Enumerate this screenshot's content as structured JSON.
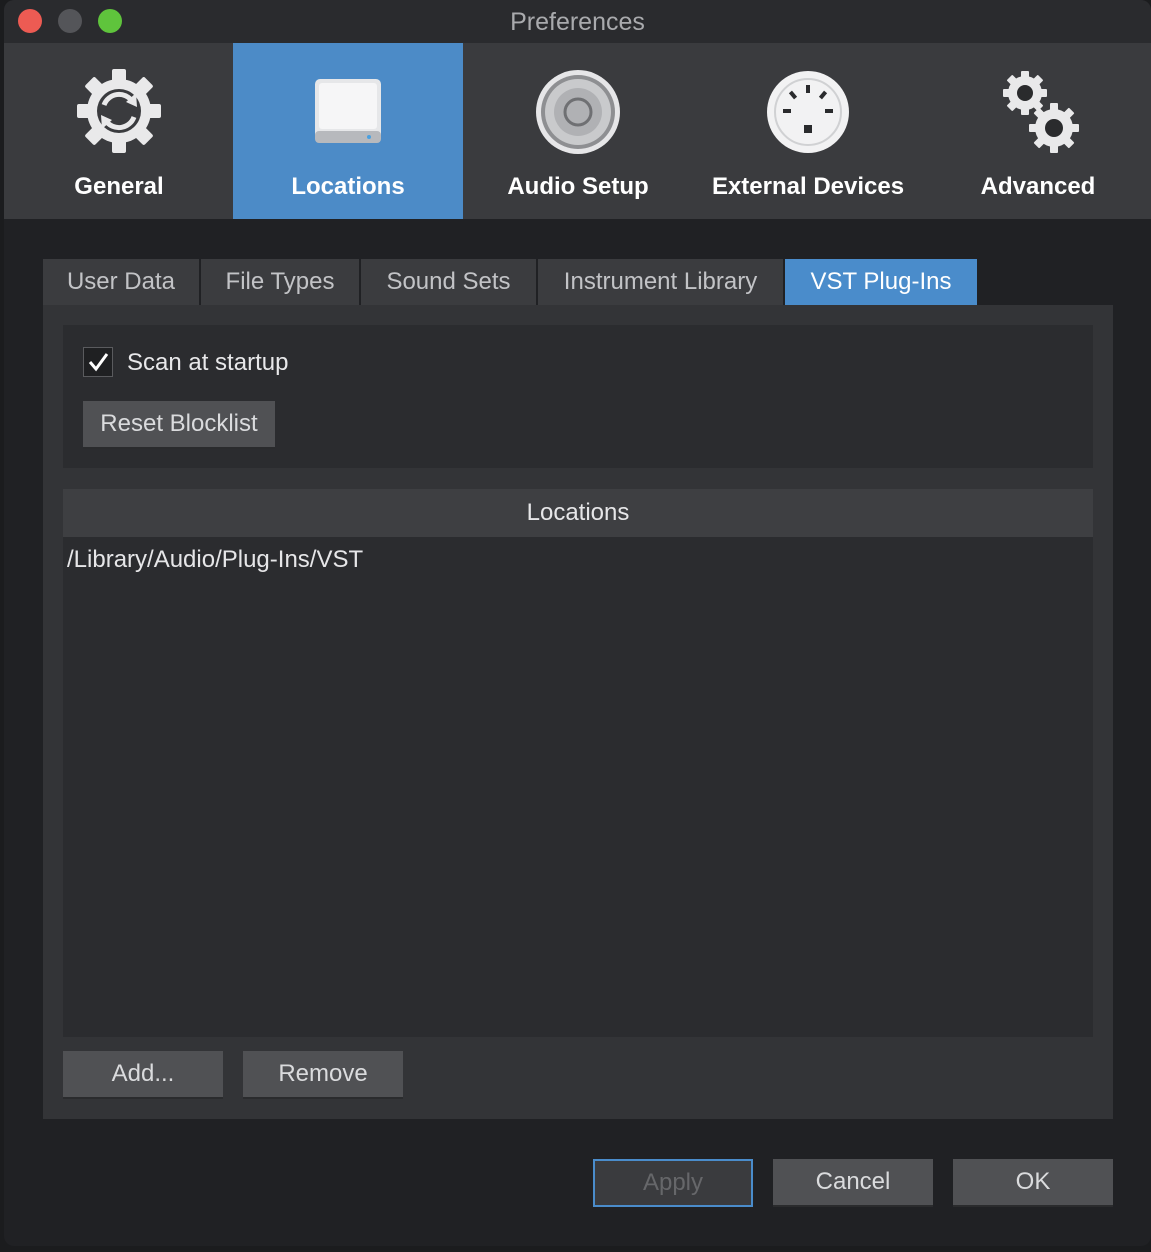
{
  "window": {
    "title": "Preferences"
  },
  "toolbar": {
    "items": [
      {
        "label": "General",
        "icon": "gear-refresh-icon",
        "active": false
      },
      {
        "label": "Locations",
        "icon": "drive-icon",
        "active": true
      },
      {
        "label": "Audio Setup",
        "icon": "speaker-icon",
        "active": false
      },
      {
        "label": "External Devices",
        "icon": "midi-connector-icon",
        "active": false
      },
      {
        "label": "Advanced",
        "icon": "gears-icon",
        "active": false
      }
    ]
  },
  "subtabs": [
    {
      "label": "User Data",
      "active": false
    },
    {
      "label": "File Types",
      "active": false
    },
    {
      "label": "Sound Sets",
      "active": false
    },
    {
      "label": "Instrument Library",
      "active": false
    },
    {
      "label": "VST Plug-Ins",
      "active": true
    }
  ],
  "options": {
    "scan_at_startup": {
      "label": "Scan at startup",
      "checked": true
    },
    "reset_blocklist_label": "Reset Blocklist"
  },
  "locations": {
    "header": "Locations",
    "paths": [
      "/Library/Audio/Plug-Ins/VST"
    ],
    "add_label": "Add...",
    "remove_label": "Remove"
  },
  "footer": {
    "apply_label": "Apply",
    "cancel_label": "Cancel",
    "ok_label": "OK"
  },
  "colors": {
    "accent": "#4a8ccb",
    "toolbar_bg": "#3a3b3e",
    "panel_bg": "#333437",
    "close": "#ed5b53",
    "maximize": "#5fc43c"
  }
}
